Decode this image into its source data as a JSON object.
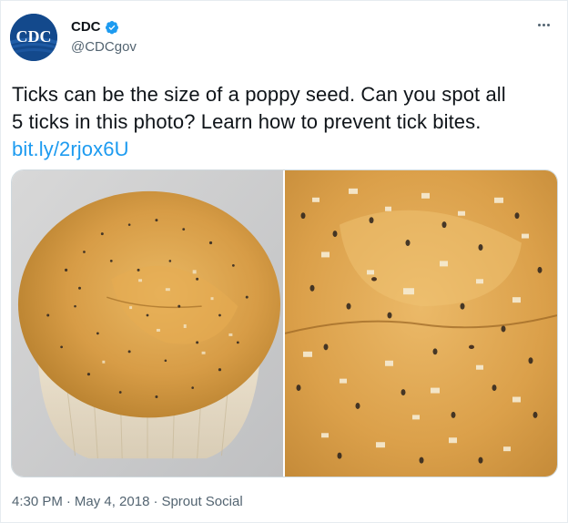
{
  "author": {
    "display_name": "CDC",
    "handle": "@CDCgov",
    "avatar_text": "CDC",
    "verified": true
  },
  "tweet": {
    "text_line1": "Ticks can be the size of a poppy seed. Can you spot all",
    "text_line2": "5 ticks in this photo? Learn how to prevent tick bites.",
    "link": "bit.ly/2rjox6U"
  },
  "footer": {
    "time": "4:30 PM",
    "sep1": "·",
    "date": "May 4, 2018",
    "sep2": "·",
    "source": "Sprout Social"
  },
  "colors": {
    "link": "#1d9bf0",
    "muted": "#536471",
    "verified": "#1d9bf0",
    "cdc_blue": "#13498c"
  },
  "icons": {
    "verified": "verified-badge-icon",
    "more": "more-options-icon"
  }
}
